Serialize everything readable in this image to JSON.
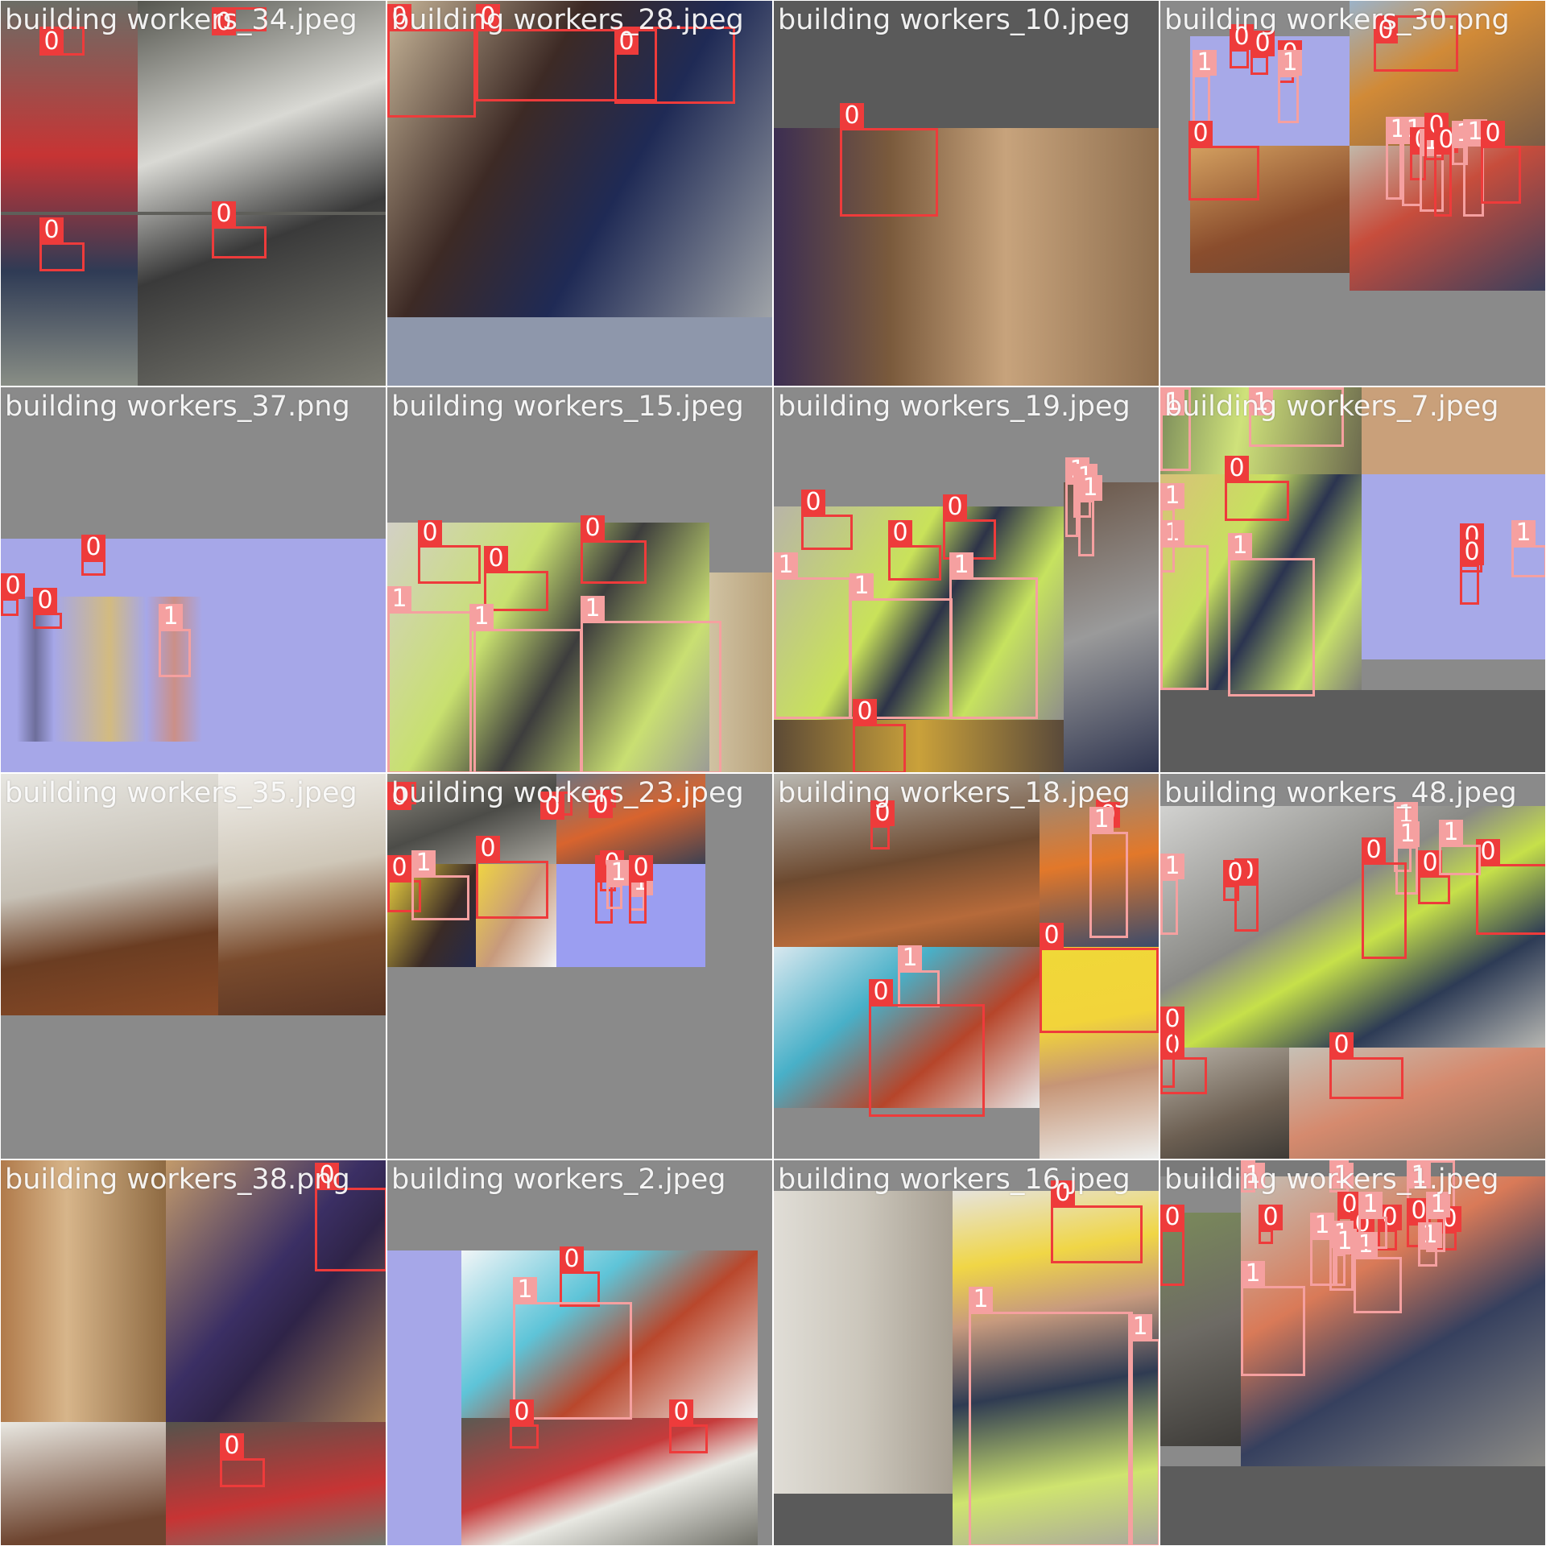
{
  "image": {
    "kind": "YOLO training batch mosaic",
    "grid": "4x4",
    "box_colors": {
      "0": "#ee3b3b",
      "1": "#f5a0a0"
    },
    "background_gray": "#8a8a8a"
  },
  "tiles": [
    {
      "title": "building workers_34.jpeg",
      "labels": [
        "0",
        "0",
        "0",
        "0"
      ]
    },
    {
      "title": "building workers_28.jpeg",
      "labels": [
        "0",
        "0",
        "0"
      ]
    },
    {
      "title": "building workers_10.jpeg",
      "labels": [
        "0"
      ]
    },
    {
      "title": "building workers_30.png",
      "labels": [
        "0",
        "0",
        "0",
        "1",
        "1",
        "0",
        "0",
        "1",
        "1",
        "0",
        "1",
        "0",
        "0",
        "1",
        "1",
        "0"
      ]
    },
    {
      "title": "building workers_37.png",
      "labels": [
        "0",
        "0",
        "0",
        "1"
      ]
    },
    {
      "title": "building workers_15.jpeg",
      "labels": [
        "0",
        "0",
        "0",
        "1",
        "1",
        "1"
      ]
    },
    {
      "title": "building workers_19.jpeg",
      "labels": [
        "0",
        "0",
        "0",
        "1",
        "1",
        "1",
        "0",
        "1",
        "1",
        "1"
      ]
    },
    {
      "title": "building workers_7.jpeg",
      "labels": [
        "1",
        "1",
        "0",
        "1",
        "1",
        "1",
        "0",
        "0",
        "1"
      ]
    },
    {
      "title": "building workers_35.jpeg",
      "labels": []
    },
    {
      "title": "building workers_23.jpeg",
      "labels": [
        "0",
        "0",
        "0",
        "0",
        "1",
        "0",
        "0",
        "0",
        "1",
        "1",
        "0"
      ]
    },
    {
      "title": "building workers_18.jpeg",
      "labels": [
        "0",
        "0",
        "1",
        "0",
        "1",
        "0",
        "1",
        "0"
      ]
    },
    {
      "title": "building workers_48.jpeg",
      "labels": [
        "1",
        "1",
        "0",
        "0",
        "0",
        "1",
        "0",
        "0",
        "1",
        "0",
        "0",
        "0"
      ]
    },
    {
      "title": "building workers_38.png",
      "labels": [
        "0",
        "0"
      ]
    },
    {
      "title": "building workers_2.jpeg",
      "labels": [
        "0",
        "1",
        "0",
        "0"
      ]
    },
    {
      "title": "building workers_16.jpeg",
      "labels": [
        "0",
        "1",
        "1"
      ]
    },
    {
      "title": "building workers_1.jpeg",
      "labels": [
        "1",
        "1",
        "1",
        "0",
        "0",
        "1",
        "1",
        "1",
        "0",
        "0",
        "0",
        "1",
        "0",
        "0",
        "1",
        "1",
        "1",
        "1"
      ]
    }
  ]
}
